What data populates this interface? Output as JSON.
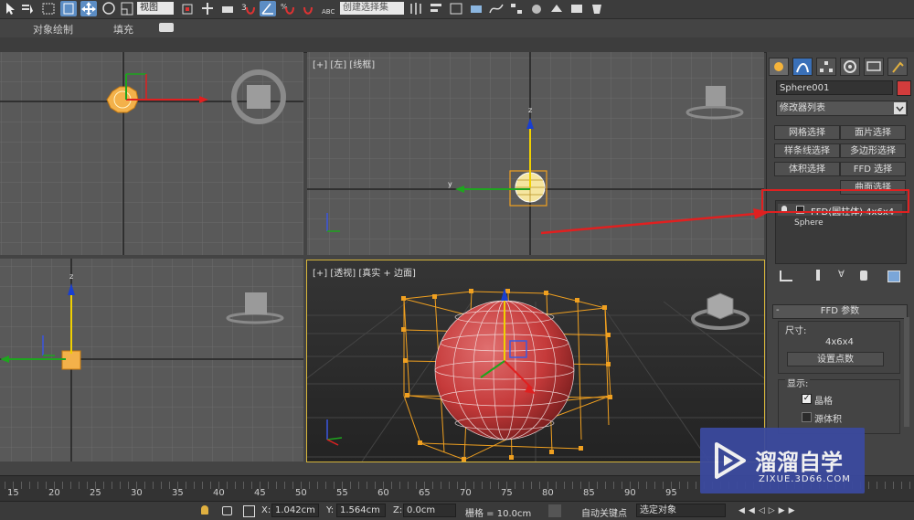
{
  "toolbar": {
    "selection_filter": "视图",
    "named_selection": "创建选择集"
  },
  "ribbon": {
    "tabs": [
      "对象绘制",
      "填充"
    ]
  },
  "viewports": {
    "left_label": "[+] [左] [线框]",
    "perspective_label": "[+] [透视] [真实 + 边面]",
    "viewcube_left": "左",
    "viewcube_other": "左",
    "viewcube_persp": "左"
  },
  "command_panel": {
    "object_name": "Sphere001",
    "object_color": "#d23c3c",
    "modifier_list": "修改器列表",
    "buttons": [
      "网格选择",
      "面片选择",
      "样条线选择",
      "多边形选择",
      "体积选择",
      "FFD 选择",
      "曲面选择"
    ],
    "stack": {
      "modifier": "FFD(圆柱体) 4x6x4",
      "base": "Sphere"
    },
    "rollout_title": "FFD 参数",
    "dimensions_group": "尺寸:",
    "dimensions_value": "4x6x4",
    "set_points_button": "设置点数",
    "display_group": "显示:",
    "lattice_label": "晶格",
    "lattice_checked": true,
    "source_volume_label": "源体积",
    "source_volume_checked": false
  },
  "timeline": {
    "ticks": [
      "15",
      "20",
      "25",
      "30",
      "35",
      "40",
      "45",
      "50",
      "55",
      "60",
      "65",
      "70",
      "75",
      "80",
      "85",
      "90",
      "95"
    ]
  },
  "status": {
    "x_label": "X:",
    "x_value": "1.042cm",
    "y_label": "Y:",
    "y_value": "1.564cm",
    "z_label": "Z:",
    "z_value": "0.0cm",
    "grid": "栅格 = 10.0cm",
    "auto_key": "自动关键点",
    "key_filter": "选定对象"
  },
  "watermark": {
    "title": "溜溜自学",
    "url": "ZIXUE.3D66.COM"
  },
  "colors": {
    "highlight_red": "#e02020",
    "selection_orange": "#f0a020",
    "sphere_red": "#c53a3a"
  }
}
